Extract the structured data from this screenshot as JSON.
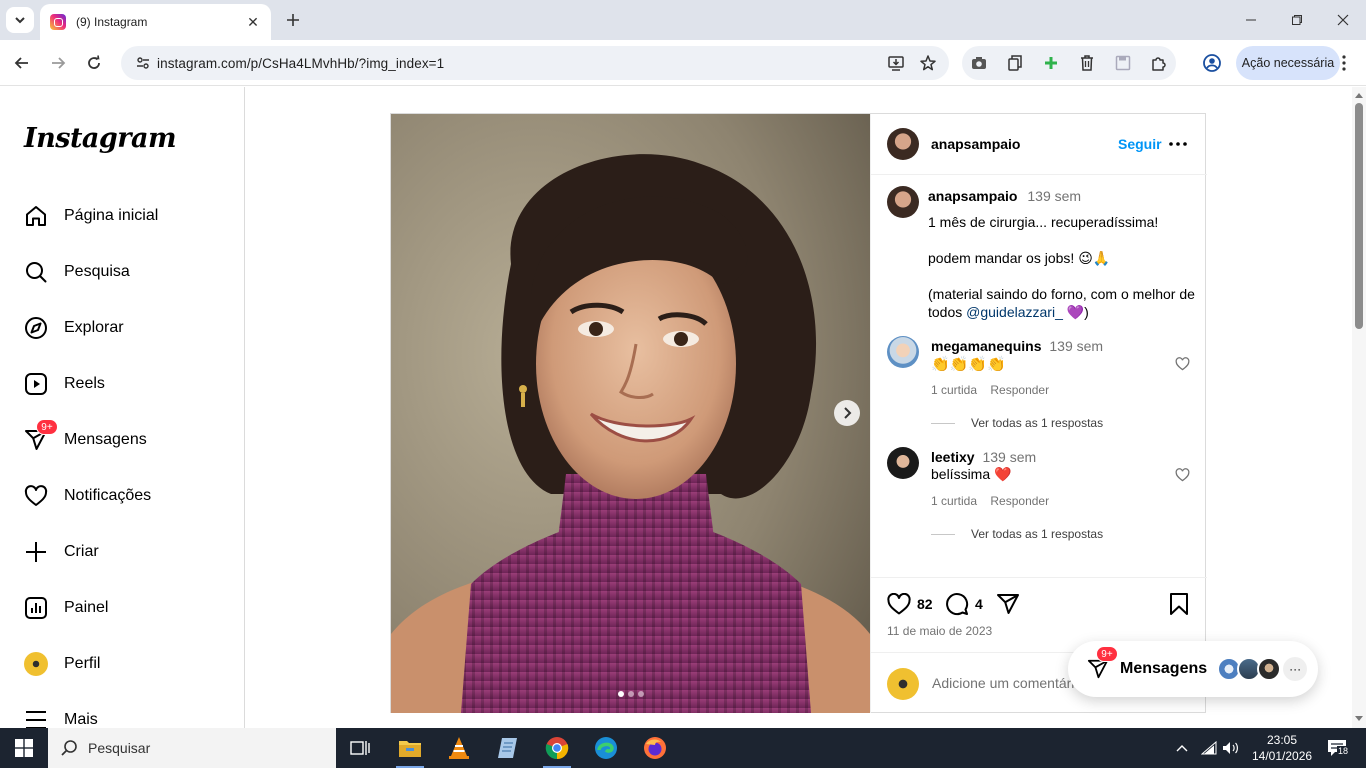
{
  "browser": {
    "tab_title": "(9) Instagram",
    "url": "instagram.com/p/CsHa4LMvhHb/?img_index=1",
    "action_label": "Ação necessária"
  },
  "sidebar": {
    "logo": "Instagram",
    "items": [
      {
        "label": "Página inicial",
        "icon": "home-icon"
      },
      {
        "label": "Pesquisa",
        "icon": "search-icon"
      },
      {
        "label": "Explorar",
        "icon": "compass-icon"
      },
      {
        "label": "Reels",
        "icon": "reels-icon"
      },
      {
        "label": "Mensagens",
        "icon": "messenger-icon",
        "badge": "9+"
      },
      {
        "label": "Notificações",
        "icon": "heart-icon"
      },
      {
        "label": "Criar",
        "icon": "plus-icon"
      },
      {
        "label": "Painel",
        "icon": "dashboard-icon"
      },
      {
        "label": "Perfil",
        "icon": "profile-avatar"
      },
      {
        "label": "Mais",
        "icon": "menu-icon"
      }
    ]
  },
  "post": {
    "author": "anapsampaio",
    "follow_label": "Seguir",
    "caption": {
      "author": "anapsampaio",
      "time": "139 sem",
      "line1": "1 mês de cirurgia... recuperadíssima!",
      "line2": "podem mandar os jobs! 😉🙏",
      "line3": "(material saindo do forno, com o melhor de todos ",
      "mention": "@guidelazzari_",
      "line3_end": " 💜)"
    },
    "comments": [
      {
        "user": "megamanequins",
        "time": "139 sem",
        "text": "👏👏👏👏",
        "likes": "1 curtida",
        "reply": "Responder",
        "view_replies": "Ver todas as 1 respostas"
      },
      {
        "user": "leetixy",
        "time": "139 sem",
        "text": "belíssima ❤️",
        "likes": "1 curtida",
        "reply": "Responder",
        "view_replies": "Ver todas as 1 respostas"
      }
    ],
    "likes_count": "82",
    "comments_count": "4",
    "date": "11 de maio de 2023",
    "comment_placeholder": "Adicione um comentário..."
  },
  "messages_pill": {
    "label": "Mensagens",
    "badge": "9+"
  },
  "taskbar": {
    "search_label": "Pesquisar",
    "time": "23:05",
    "date": "14/01/2026",
    "notif_count": "18"
  }
}
